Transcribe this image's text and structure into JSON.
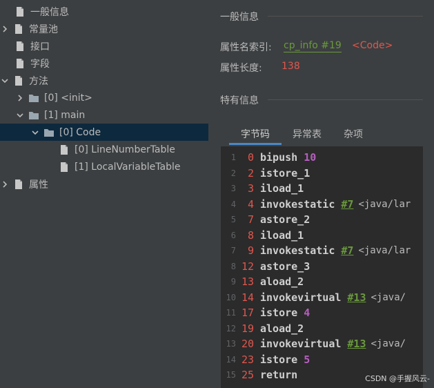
{
  "tree": {
    "items": [
      {
        "label": "一般信息",
        "icon": "file-icon"
      },
      {
        "label": "常量池",
        "icon": "chevron-right-icon"
      },
      {
        "label": "接口",
        "icon": "file-icon"
      },
      {
        "label": "字段",
        "icon": "file-icon"
      },
      {
        "label": "方法",
        "icon": "chevron-down-icon"
      },
      {
        "label": "[0] <init>",
        "icon": "folder-icon"
      },
      {
        "label": "[1] main",
        "icon": "folder-icon"
      },
      {
        "label": "[0] Code",
        "icon": "folder-icon",
        "selected": true
      },
      {
        "label": "[0] LineNumberTable",
        "icon": "file-icon"
      },
      {
        "label": "[1] LocalVariableTable",
        "icon": "file-icon"
      },
      {
        "label": "属性",
        "icon": "chevron-right-icon"
      }
    ]
  },
  "detail": {
    "general_title": "一般信息",
    "name_index_label": "属性名索引:",
    "name_index_link": "cp_info #19",
    "name_index_value": "<Code>",
    "length_label": "属性长度:",
    "length_value": "138",
    "specific_title": "特有信息",
    "tabs": [
      "字节码",
      "异常表",
      "杂项"
    ]
  },
  "code": {
    "lines": [
      {
        "ln": "1",
        "off": "0",
        "op": "bipush",
        "num": "10"
      },
      {
        "ln": "2",
        "off": "2",
        "op": "istore_1"
      },
      {
        "ln": "3",
        "off": "3",
        "op": "iload_1"
      },
      {
        "ln": "4",
        "off": "4",
        "op": "invokestatic",
        "ref": "#7",
        "txt": "<java/lar"
      },
      {
        "ln": "5",
        "off": "7",
        "op": "astore_2"
      },
      {
        "ln": "6",
        "off": "8",
        "op": "iload_1"
      },
      {
        "ln": "7",
        "off": "9",
        "op": "invokestatic",
        "ref": "#7",
        "txt": "<java/lar"
      },
      {
        "ln": "8",
        "off": "12",
        "op": "astore_3"
      },
      {
        "ln": "9",
        "off": "13",
        "op": "aload_2"
      },
      {
        "ln": "10",
        "off": "14",
        "op": "invokevirtual",
        "ref": "#13",
        "txt": "<java/"
      },
      {
        "ln": "11",
        "off": "17",
        "op": "istore",
        "num": "4"
      },
      {
        "ln": "12",
        "off": "19",
        "op": "aload_2"
      },
      {
        "ln": "13",
        "off": "20",
        "op": "invokevirtual",
        "ref": "#13",
        "txt": "<java/"
      },
      {
        "ln": "14",
        "off": "23",
        "op": "istore",
        "num": "5"
      },
      {
        "ln": "15",
        "off": "25",
        "op": "return"
      }
    ]
  },
  "watermark": "CSDN @手握风云-",
  "colors": {
    "panel": "#3c3f41",
    "editor": "#2b2b2b",
    "selection": "#0d293e",
    "accent_tab": "#4a88c7",
    "offset_red": "#e2564d",
    "link_green": "#6a9a3c",
    "number_purple": "#b55fbf"
  }
}
